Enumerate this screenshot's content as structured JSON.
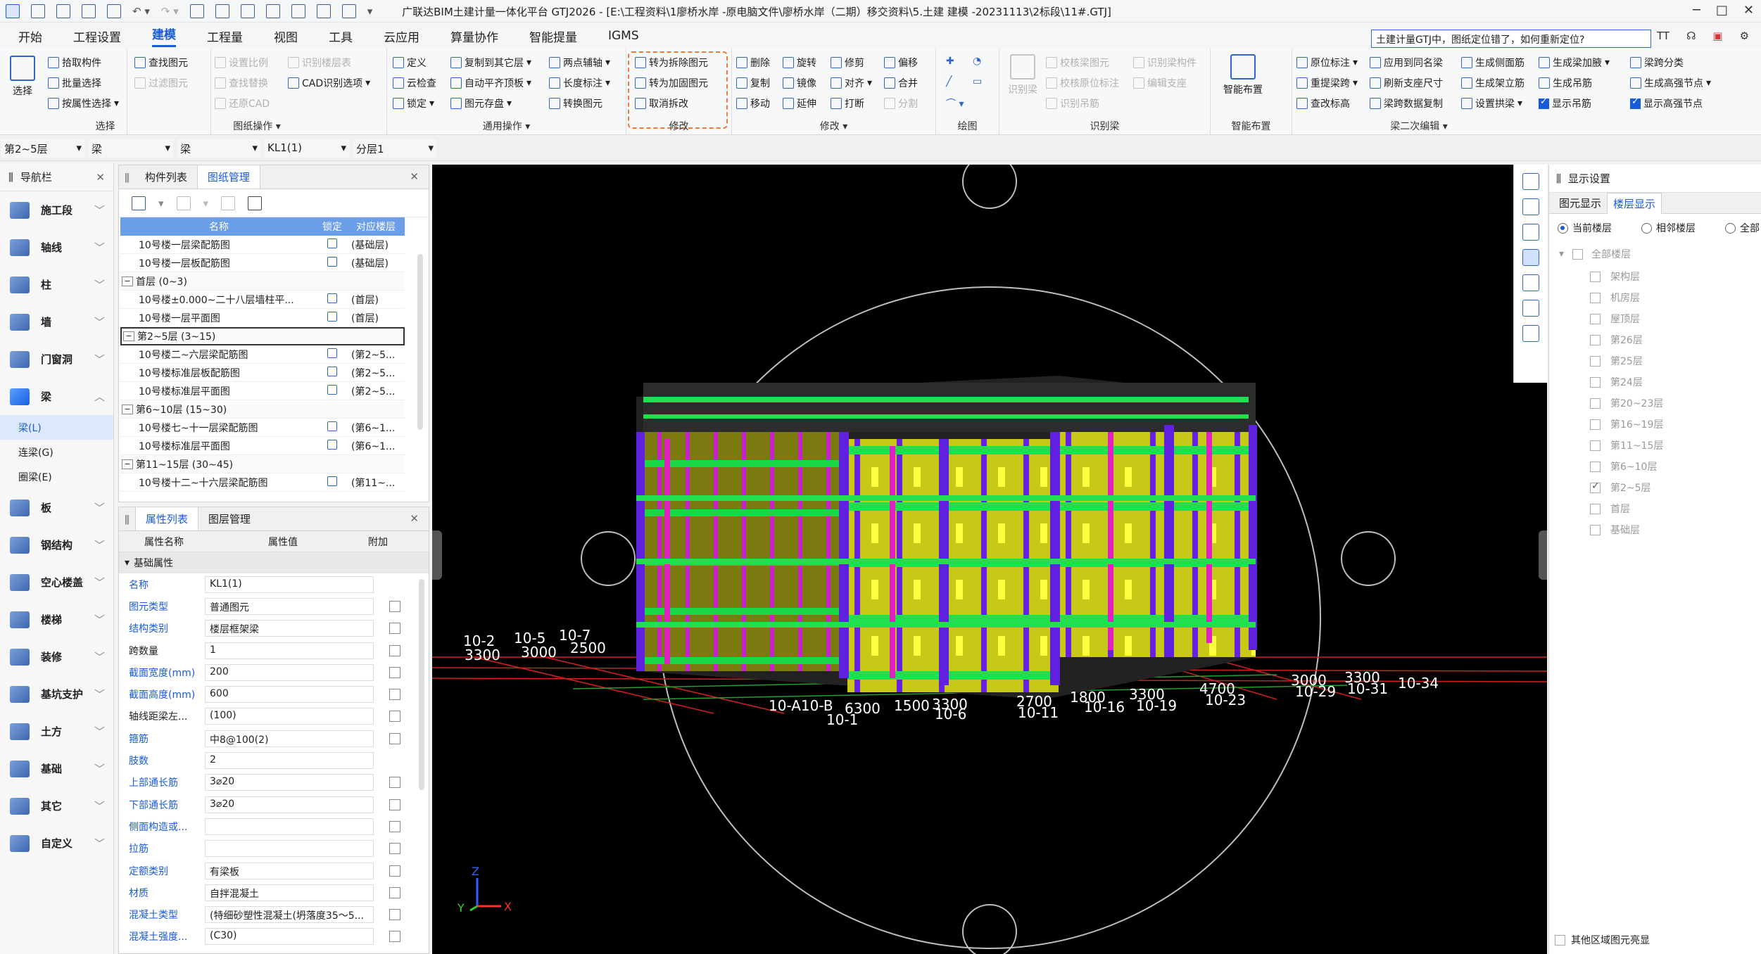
{
  "title": "广联达BIM土建计量一体化平台 GTJ2026 - [E:\\工程资料\\1廖桥水岸 -原电脑文件\\廖桥水岸（二期）移交资料\\5.土建 建模 -20231113\\2标段\\11#.GTJ]",
  "menu": {
    "tabs": [
      "开始",
      "工程设置",
      "建模",
      "工程量",
      "视图",
      "工具",
      "云应用",
      "算量协作",
      "智能提量",
      "IGMS"
    ],
    "active": "建模",
    "search_value": "土建计量GTJ中，图纸定位错了，如何重新定位?",
    "right_items": [
      "TT"
    ]
  },
  "ribbon": {
    "select": {
      "label": "选择",
      "big": "选择",
      "items": [
        "拾取构件",
        "批量选择",
        "按属性选择"
      ]
    },
    "drawing": {
      "label": "图纸操作",
      "items": [
        "查找图元",
        "过滤图元",
        "设置比例",
        "查找替换",
        "还原CAD",
        "识别楼层表",
        "CAD识别选项"
      ]
    },
    "general": {
      "label": "通用操作",
      "items": [
        "定义",
        "云检查",
        "锁定",
        "复制到其它层",
        "自动平齐顶板",
        "图元存盘",
        "两点辅轴",
        "长度标注",
        "转换图元"
      ]
    },
    "modify_hl": {
      "label": "修改",
      "items": [
        "转为拆除图元",
        "转为加固图元",
        "取消拆改"
      ]
    },
    "modify": {
      "label": "修改",
      "items": [
        "删除",
        "复制",
        "移动",
        "旋转",
        "镜像",
        "延伸",
        "修剪",
        "对齐",
        "打断",
        "偏移",
        "合并",
        "分割"
      ]
    },
    "draw": {
      "label": "绘图"
    },
    "recog": {
      "label": "识别梁",
      "big": "识别梁",
      "items": [
        "校核梁图元",
        "校核原位标注",
        "识别吊筋",
        "识别梁构件",
        "编辑支座"
      ]
    },
    "smart": {
      "label": "智能布置",
      "big": "智能布置"
    },
    "beam2": {
      "label": "梁二次编辑",
      "items": [
        "原位标注",
        "重提梁跨",
        "查改标高",
        "应用到同名梁",
        "刷新支座尺寸",
        "梁跨数据复制",
        "生成侧面筋",
        "生成架立筋",
        "设置拱梁",
        "生成梁加腋",
        "生成吊筋",
        "显示吊筋",
        "梁跨分类",
        "生成高强节点",
        "显示高强节点"
      ]
    }
  },
  "selectors": [
    "第2~5层",
    "梁",
    "梁",
    "KL1(1)",
    "分层1"
  ],
  "nav": {
    "title": "导航栏",
    "items": [
      "施工段",
      "轴线",
      "柱",
      "墙",
      "门窗洞",
      "梁",
      "板",
      "钢结构",
      "空心楼盖",
      "楼梯",
      "装修",
      "基坑支护",
      "土方",
      "基础",
      "其它",
      "自定义"
    ],
    "beam_sub": [
      "梁(L)",
      "连梁(G)",
      "圈梁(E)"
    ]
  },
  "drawing_panel": {
    "tabs": [
      "构件列表",
      "图纸管理"
    ],
    "headers": [
      "名称",
      "锁定",
      "对应楼层"
    ],
    "rows": [
      {
        "type": "item",
        "name": "10号楼一层梁配筋图",
        "floor": "(基础层)"
      },
      {
        "type": "item",
        "name": "10号楼一层板配筋图",
        "floor": "(基础层)"
      },
      {
        "type": "group",
        "name": "首层 (0~3)"
      },
      {
        "type": "item",
        "name": "10号楼±0.000~二十八层墙柱平...",
        "floor": "(首层)"
      },
      {
        "type": "item",
        "name": "10号楼一层平面图",
        "floor": "(首层)"
      },
      {
        "type": "group",
        "name": "第2~5层 (3~15)"
      },
      {
        "type": "item",
        "name": "10号楼二~六层梁配筋图",
        "floor": "(第2~5..."
      },
      {
        "type": "item",
        "name": "10号楼标准层板配筋图",
        "floor": "(第2~5..."
      },
      {
        "type": "item",
        "name": "10号楼标准层平面图",
        "floor": "(第2~5..."
      },
      {
        "type": "group",
        "name": "第6~10层 (15~30)"
      },
      {
        "type": "item",
        "name": "10号楼七~十一层梁配筋图",
        "floor": "(第6~1..."
      },
      {
        "type": "item",
        "name": "10号楼标准层平面图",
        "floor": "(第6~1..."
      },
      {
        "type": "group",
        "name": "第11~15层 (30~45)"
      },
      {
        "type": "item",
        "name": "10号楼十二~十六层梁配筋图",
        "floor": "(第11~..."
      }
    ]
  },
  "prop_panel": {
    "tabs": [
      "属性列表",
      "图层管理"
    ],
    "headers": [
      "属性名称",
      "属性值",
      "附加"
    ],
    "section": "基础属性",
    "rows": [
      {
        "name": "名称",
        "value": "KL1(1)",
        "blue": true,
        "check": false
      },
      {
        "name": "图元类型",
        "value": "普通图元",
        "blue": true,
        "check": true
      },
      {
        "name": "结构类别",
        "value": "楼层框架梁",
        "blue": true,
        "check": true
      },
      {
        "name": "跨数量",
        "value": "1",
        "blue": false,
        "check": true
      },
      {
        "name": "截面宽度(mm)",
        "value": "200",
        "blue": true,
        "check": true
      },
      {
        "name": "截面高度(mm)",
        "value": "600",
        "blue": true,
        "check": true
      },
      {
        "name": "轴线距梁左...",
        "value": "(100)",
        "blue": false,
        "check": true
      },
      {
        "name": "箍筋",
        "value": "中8@100(2)",
        "blue": true,
        "check": true
      },
      {
        "name": "肢数",
        "value": "2",
        "blue": true,
        "check": false
      },
      {
        "name": "上部通长筋",
        "value": "3⌀20",
        "blue": true,
        "check": true
      },
      {
        "name": "下部通长筋",
        "value": "3⌀20",
        "blue": true,
        "check": true
      },
      {
        "name": "侧面构造或...",
        "value": "",
        "blue": true,
        "check": true
      },
      {
        "name": "拉筋",
        "value": "",
        "blue": true,
        "check": true
      },
      {
        "name": "定额类别",
        "value": "有梁板",
        "blue": true,
        "check": true
      },
      {
        "name": "材质",
        "value": "自拌混凝土",
        "blue": true,
        "check": true
      },
      {
        "name": "混凝土类型",
        "value": "(特细砂塑性混凝土(坍落度35～5...",
        "blue": true,
        "check": true
      },
      {
        "name": "混凝土强度...",
        "value": "(C30)",
        "blue": true,
        "check": true
      }
    ]
  },
  "display": {
    "title": "显示设置",
    "tabs": [
      "图元显示",
      "楼层显示"
    ],
    "radios": [
      "当前楼层",
      "相邻楼层",
      "全部"
    ],
    "tree_root": "全部楼层",
    "floors": [
      {
        "name": "架构层",
        "checked": false
      },
      {
        "name": "机房层",
        "checked": false
      },
      {
        "name": "屋顶层",
        "checked": false
      },
      {
        "name": "第26层",
        "checked": false
      },
      {
        "name": "第25层",
        "checked": false
      },
      {
        "name": "第24层",
        "checked": false
      },
      {
        "name": "第20~23层",
        "checked": false
      },
      {
        "name": "第16~19层",
        "checked": false
      },
      {
        "name": "第11~15层",
        "checked": false
      },
      {
        "name": "第6~10层",
        "checked": false
      },
      {
        "name": "第2~5层",
        "checked": true
      },
      {
        "name": "首层",
        "checked": false
      },
      {
        "name": "基础层",
        "checked": false
      }
    ],
    "footer": "其他区域图元亮显"
  },
  "viewport": {
    "axis_labels_left": [
      "10-2",
      "3300",
      "10-5",
      "3000",
      "10-7",
      "2500"
    ],
    "axis_labels_bottom": [
      "10-A10-B",
      "10-1",
      "6300",
      "1500",
      "3300",
      "10-6",
      "2700",
      "10-11",
      "1800",
      "10-16",
      "3300",
      "10-19",
      "4700",
      "10-23",
      "3000",
      "10-29",
      "3300",
      "10-31",
      "10-34"
    ],
    "triad": {
      "x": "X",
      "y": "Y",
      "z": "Z"
    }
  },
  "colors": {
    "accent": "#1a5bd8",
    "viewport_bg": "#000000",
    "highlight": "#f07a3a"
  }
}
